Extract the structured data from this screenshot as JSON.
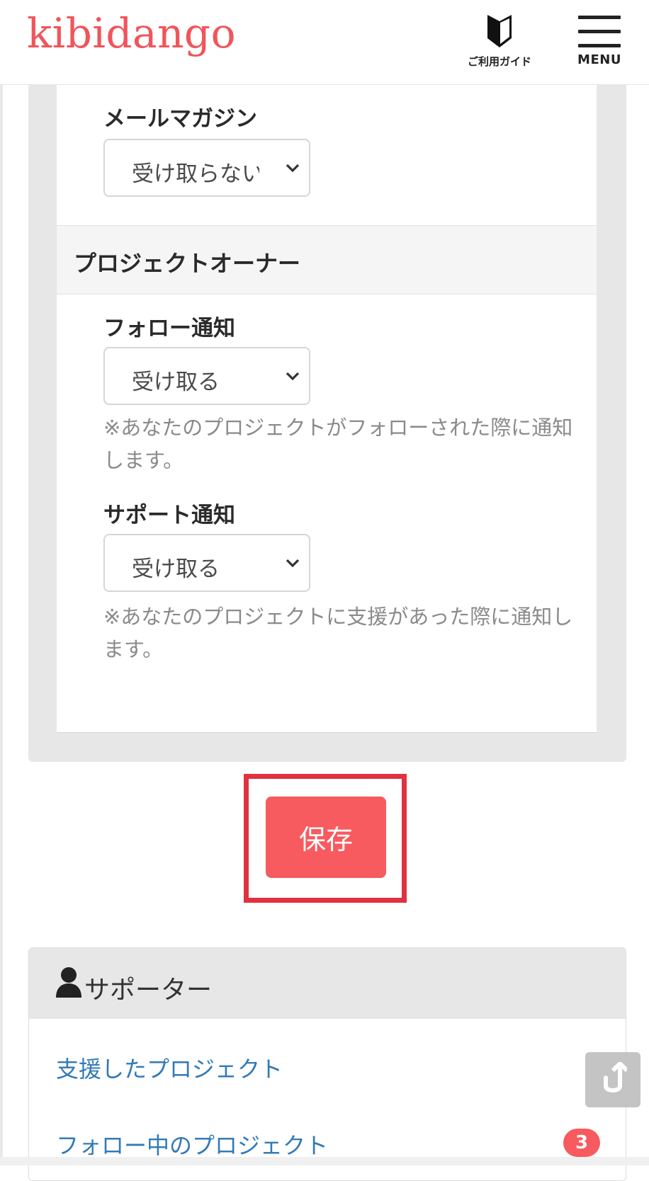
{
  "header": {
    "logo": "kibidango",
    "guide_label": "ご利用ガイド",
    "guide_icon": "beginner-mark-icon",
    "menu_label": "MENU",
    "menu_icon": "hamburger-icon"
  },
  "settings": {
    "mail_magazine": {
      "label": "メールマガジン",
      "value": "受け取らない"
    },
    "owner_section": {
      "title": "プロジェクトオーナー"
    },
    "follow_notify": {
      "label": "フォロー通知",
      "value": "受け取る",
      "note": "※あなたのプロジェクトがフォローされた際に通知します。"
    },
    "support_notify": {
      "label": "サポート通知",
      "value": "受け取る",
      "note": "※あなたのプロジェクトに支援があった際に通知します。"
    }
  },
  "save_button": {
    "label": "保存"
  },
  "supporter": {
    "title": "サポーター",
    "icon": "person-icon",
    "links": [
      {
        "label": "支援したプロジェクト"
      },
      {
        "label": "フォロー中のプロジェクト",
        "badge": "3"
      }
    ]
  },
  "colors": {
    "brand": "#f0555b",
    "button": "#f75a5f",
    "highlight": "#e0313f",
    "link": "#337ab7"
  },
  "scroll_top_icon": "scroll-to-top-icon"
}
